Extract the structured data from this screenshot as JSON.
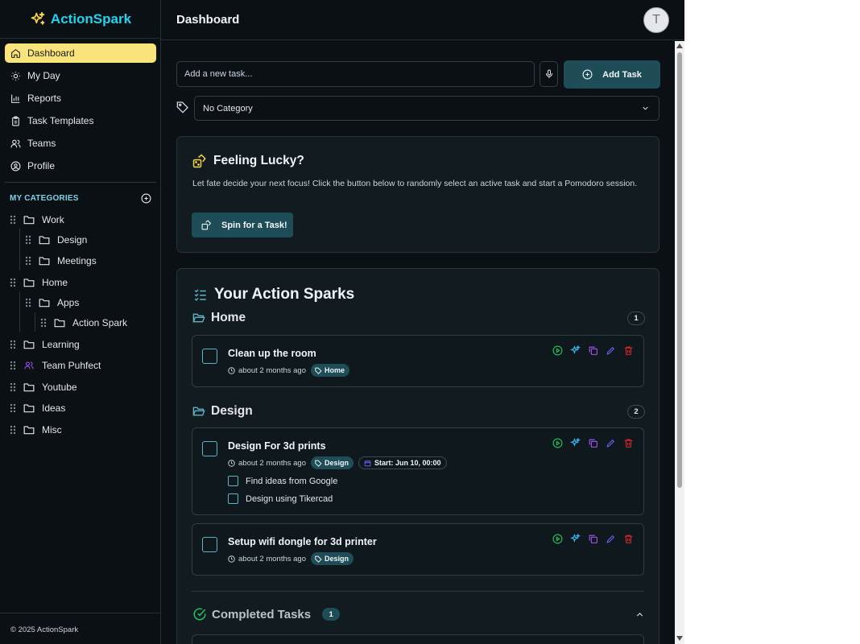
{
  "app": {
    "name": "ActionSpark",
    "footer": "© 2025 ActionSpark"
  },
  "header": {
    "title": "Dashboard",
    "avatar_initial": "T"
  },
  "nav": [
    {
      "label": "Dashboard",
      "icon": "home-icon",
      "active": true
    },
    {
      "label": "My Day",
      "icon": "sun-icon"
    },
    {
      "label": "Reports",
      "icon": "bar-chart-icon"
    },
    {
      "label": "Task Templates",
      "icon": "clipboard-icon"
    },
    {
      "label": "Teams",
      "icon": "users-icon"
    },
    {
      "label": "Profile",
      "icon": "user-circle-icon"
    }
  ],
  "categories": {
    "header": "MY CATEGORIES",
    "items": [
      "Work",
      "Design",
      "Meetings",
      "Home",
      "Apps",
      "Action Spark",
      "Learning",
      "Team Puhfect",
      "Youtube",
      "Ideas",
      "Misc"
    ]
  },
  "new_task": {
    "placeholder": "Add a new task...",
    "add_label": "Add Task",
    "category_value": "No Category"
  },
  "lucky": {
    "title": "Feeling Lucky?",
    "description": "Let fate decide your next focus! Click the button below to randomly select an active task and start a Pomodoro session.",
    "button": "Spin for a Task!"
  },
  "sparks": {
    "title": "Your Action Sparks",
    "groups": [
      {
        "name": "Home",
        "count": "1",
        "tasks": [
          {
            "title": "Clean up the room",
            "time": "about 2 months ago",
            "tag": "Home"
          }
        ]
      },
      {
        "name": "Design",
        "count": "2",
        "tasks": [
          {
            "title": "Design For 3d prints",
            "time": "about 2 months ago",
            "tag": "Design",
            "start": "Start: Jun 10, 00:00",
            "subtasks": [
              "Find ideas from Google",
              "Design using Tikercad"
            ]
          },
          {
            "title": "Setup wifi dongle for 3d printer",
            "time": "about 2 months ago",
            "tag": "Design"
          }
        ]
      }
    ]
  },
  "completed": {
    "label": "Completed Tasks",
    "count": "1"
  },
  "colors": {
    "accent": "#22d3ee",
    "active_nav": "#f8e47a",
    "button": "#1e4d57",
    "background": "#0b1014",
    "card": "#111b20"
  }
}
